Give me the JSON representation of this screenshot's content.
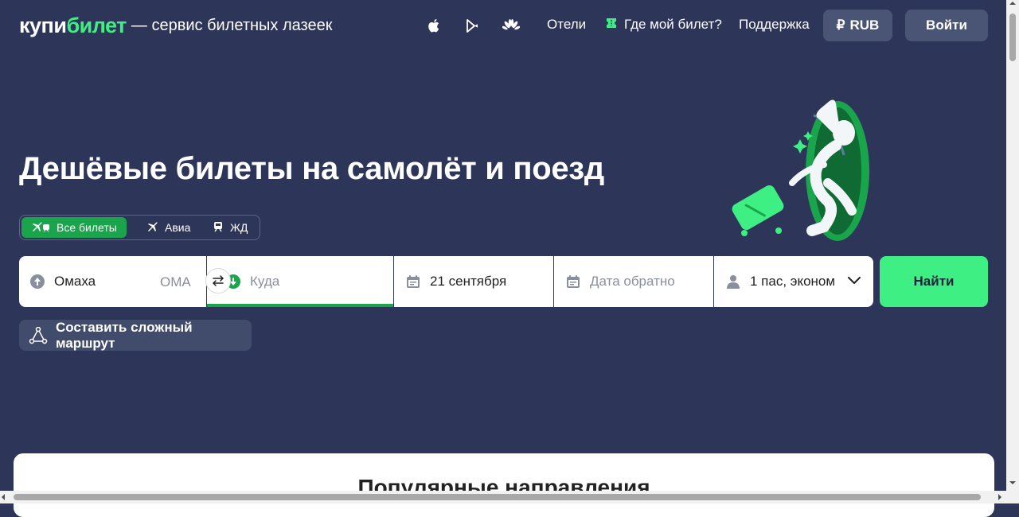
{
  "header": {
    "logo_part1": "купи",
    "logo_part2": "билет",
    "tagline": "— сервис билетных лазеек",
    "store_icons": [
      "apple-icon",
      "google-play-icon",
      "huawei-icon"
    ],
    "nav": {
      "hotels": "Отели",
      "where_ticket": "Где мой билет?",
      "support": "Поддержка"
    },
    "currency": "RUB",
    "currency_symbol": "₽",
    "login": "Войти"
  },
  "hero": {
    "title": "Дешёвые билеты на самолёт и поезд"
  },
  "ticket_types": [
    {
      "label": "Все билеты",
      "active": true,
      "icon": "plane-train-icon"
    },
    {
      "label": "Авиа",
      "active": false,
      "icon": "plane-icon"
    },
    {
      "label": "ЖД",
      "active": false,
      "icon": "train-icon"
    }
  ],
  "search": {
    "from_value": "Омаха",
    "from_code": "OMA",
    "to_placeholder": "Куда",
    "date_value": "21 сентября",
    "return_placeholder": "Дата обратно",
    "passengers": "1 пас, эконом",
    "find_label": "Найти"
  },
  "complex_route": "Составить сложный маршрут",
  "popular": {
    "title": "Популярные направления"
  },
  "colors": {
    "background": "#2d3659",
    "accent": "#3ef083",
    "accent_dark": "#1aa44b",
    "button_bg": "#4a5475"
  }
}
